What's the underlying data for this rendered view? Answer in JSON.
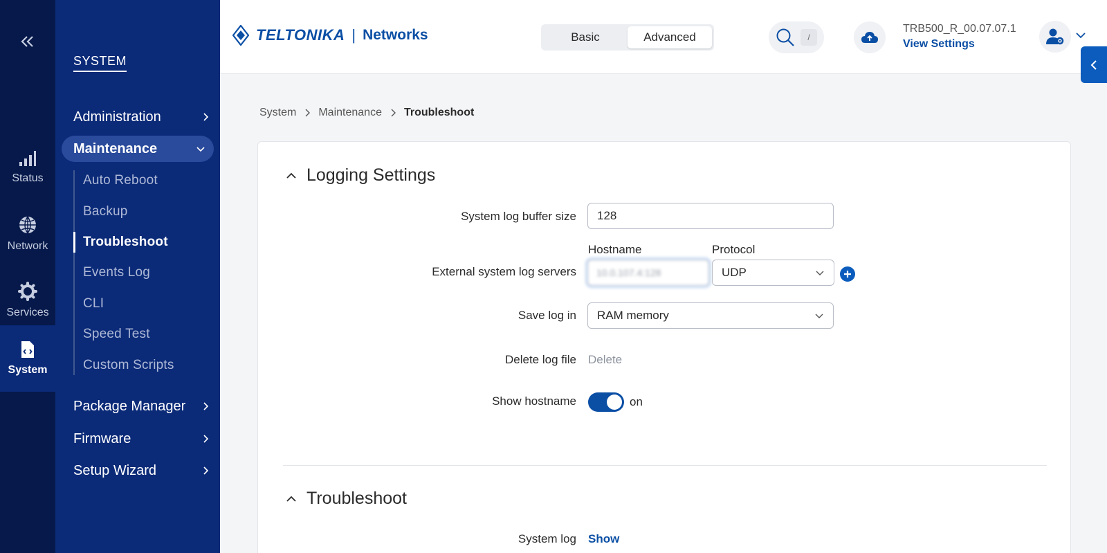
{
  "rail": {
    "items": [
      {
        "label": "Status",
        "icon": "signal-bars-icon"
      },
      {
        "label": "Network",
        "icon": "globe-icon"
      },
      {
        "label": "Services",
        "icon": "gear-icon"
      },
      {
        "label": "System",
        "icon": "code-file-icon"
      }
    ],
    "active": "System"
  },
  "sidebar": {
    "section": "SYSTEM",
    "items": [
      {
        "label": "Administration"
      },
      {
        "label": "Maintenance",
        "expanded": true
      },
      {
        "label": "Package Manager"
      },
      {
        "label": "Firmware"
      },
      {
        "label": "Setup Wizard"
      }
    ],
    "maintenance_sub": [
      {
        "label": "Auto Reboot"
      },
      {
        "label": "Backup"
      },
      {
        "label": "Troubleshoot",
        "active": true
      },
      {
        "label": "Events Log"
      },
      {
        "label": "CLI"
      },
      {
        "label": "Speed Test"
      },
      {
        "label": "Custom Scripts"
      }
    ]
  },
  "header": {
    "logo_text": "TELTONIKA",
    "logo_sep": "|",
    "logo_sub": "Networks",
    "modes": [
      "Basic",
      "Advanced"
    ],
    "selected_mode": "Advanced",
    "search_shortcut": "/",
    "device_name": "TRB500_R_00.07.07.1",
    "view_settings": "View Settings"
  },
  "breadcrumb": [
    "System",
    "Maintenance",
    "Troubleshoot"
  ],
  "logging": {
    "title": "Logging Settings",
    "buffer_label": "System log buffer size",
    "buffer_value": "128",
    "hostname_header": "Hostname",
    "protocol_header": "Protocol",
    "servers_label": "External system log servers",
    "hostname_value": "10.0.107.4:128",
    "protocol_value": "UDP",
    "save_label": "Save log in",
    "save_value": "RAM memory",
    "delete_label": "Delete log file",
    "delete_link": "Delete",
    "show_hostname_label": "Show hostname",
    "show_hostname_state": "on"
  },
  "troubleshoot": {
    "title": "Troubleshoot",
    "syslog_label": "System log",
    "syslog_link": "Show"
  },
  "colors": {
    "rail_bg": "#06194a",
    "sidebar_bg": "#0b2a78",
    "accent": "#0b4fa5"
  }
}
